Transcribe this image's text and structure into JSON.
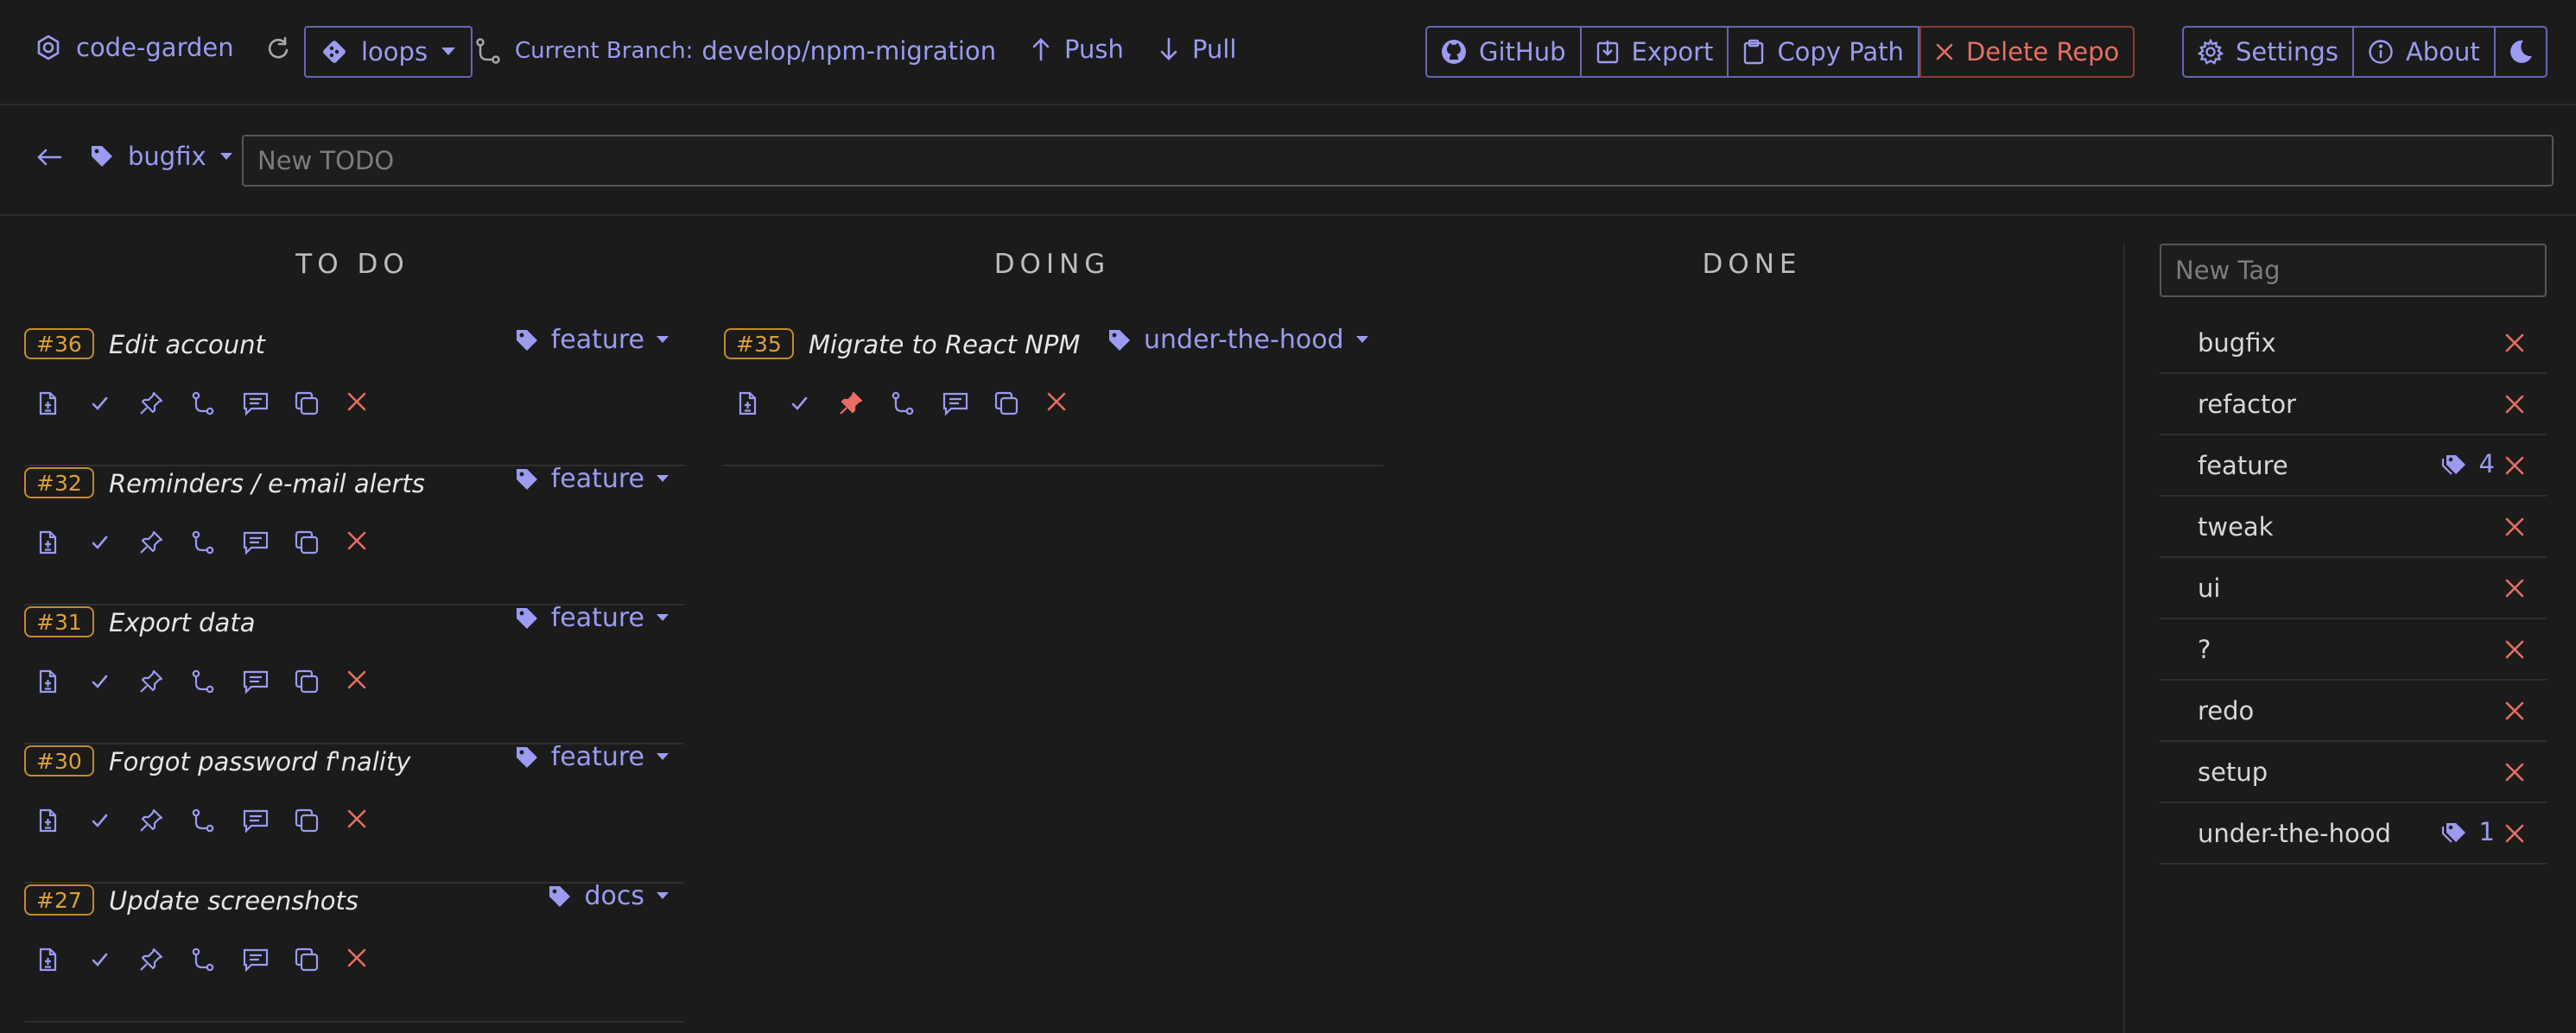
{
  "topbar": {
    "repo_name": "code-garden",
    "branch_select": "loops",
    "current_branch_label": "Current Branch:",
    "current_branch": "develop/npm-migration",
    "push": "Push",
    "pull": "Pull",
    "github": "GitHub",
    "export": "Export",
    "copy_path": "Copy Path",
    "delete_repo": "Delete Repo",
    "settings": "Settings",
    "about": "About"
  },
  "todo_input": {
    "filter_tag": "bugfix",
    "placeholder": "New TODO"
  },
  "columns": {
    "todo": "TO DO",
    "doing": "DOING",
    "done": "DONE"
  },
  "cards": {
    "todo": [
      {
        "num": "#36",
        "title": "Edit account",
        "tag": "feature"
      },
      {
        "num": "#32",
        "title": "Reminders / e-mail alerts",
        "tag": "feature"
      },
      {
        "num": "#31",
        "title": "Export data",
        "tag": "feature"
      },
      {
        "num": "#30",
        "title": "Forgot password f'nality",
        "tag": "feature"
      },
      {
        "num": "#27",
        "title": "Update screenshots",
        "tag": "docs"
      }
    ],
    "doing": [
      {
        "num": "#35",
        "title": "Migrate to React NPM",
        "tag": "under-the-hood"
      }
    ]
  },
  "tags": {
    "placeholder": "New Tag",
    "items": [
      {
        "name": "bugfix"
      },
      {
        "name": "refactor"
      },
      {
        "name": "feature",
        "count": "4"
      },
      {
        "name": "tweak"
      },
      {
        "name": "ui"
      },
      {
        "name": "?"
      },
      {
        "name": "redo"
      },
      {
        "name": "setup"
      },
      {
        "name": "under-the-hood",
        "count": "1"
      }
    ]
  },
  "colors": {
    "accent": "#9b9bf2",
    "danger": "#e86e62",
    "badge": "#dba13a",
    "background": "#1b1b1b"
  }
}
